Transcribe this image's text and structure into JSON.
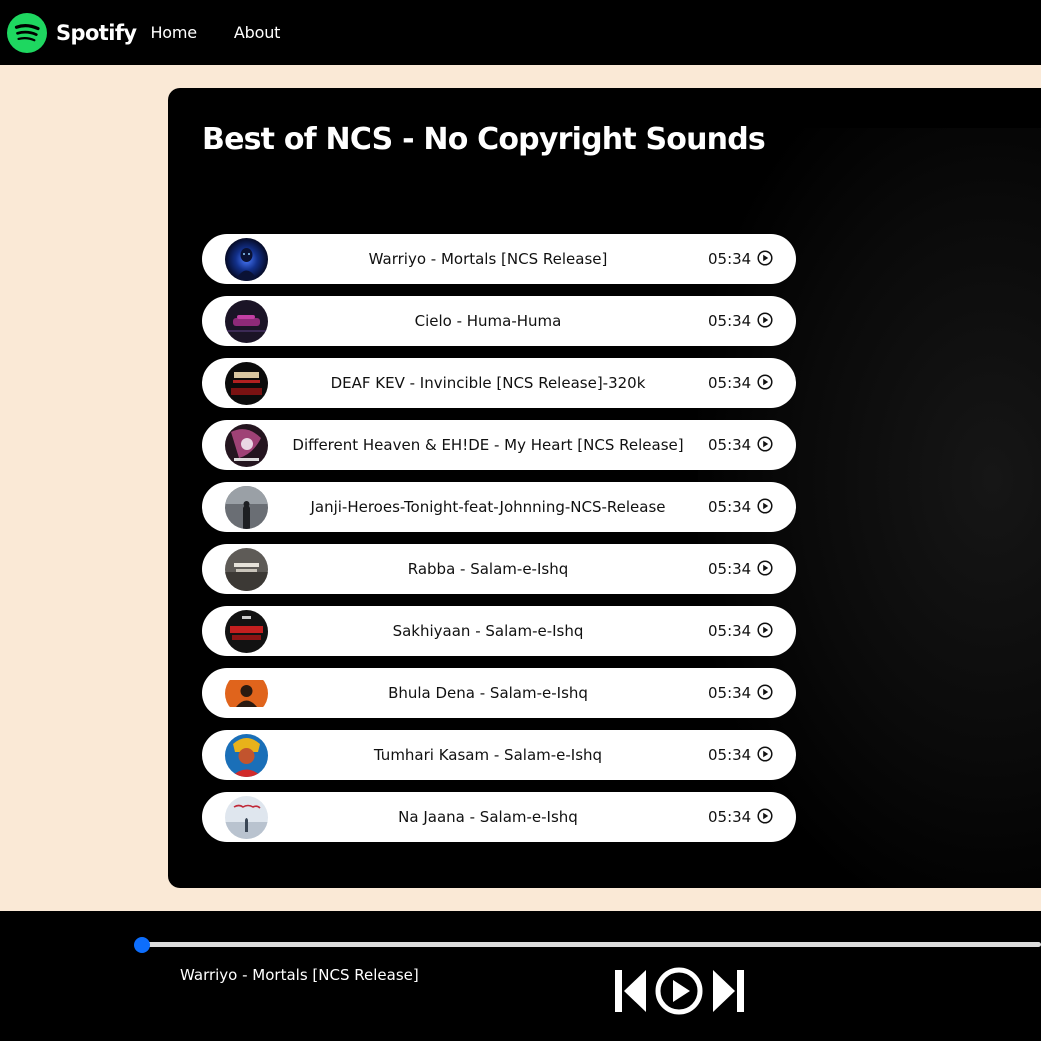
{
  "nav": {
    "brand": "Spotify",
    "links": [
      "Home",
      "About"
    ]
  },
  "playlist": {
    "title": "Best of NCS - No Copyright Sounds",
    "songs": [
      {
        "name": "Warriyo - Mortals [NCS Release]",
        "duration": "05:34",
        "cover": "cover-blue-figure"
      },
      {
        "name": "Cielo - Huma-Huma",
        "duration": "05:34",
        "cover": "cover-neon-car"
      },
      {
        "name": "DEAF KEV - Invincible [NCS Release]-320k",
        "duration": "05:34",
        "cover": "cover-red-text"
      },
      {
        "name": "Different Heaven & EH!DE - My Heart [NCS Release]",
        "duration": "05:34",
        "cover": "cover-pink-art"
      },
      {
        "name": "Janji-Heroes-Tonight-feat-Johnning-NCS-Release",
        "duration": "05:34",
        "cover": "cover-grey-figure"
      },
      {
        "name": "Rabba - Salam-e-Ishq",
        "duration": "05:34",
        "cover": "cover-grey-text"
      },
      {
        "name": "Sakhiyaan - Salam-e-Ishq",
        "duration": "05:34",
        "cover": "cover-red-text-dark"
      },
      {
        "name": "Bhula Dena - Salam-e-Ishq",
        "duration": "05:34",
        "cover": "cover-orange-portrait"
      },
      {
        "name": "Tumhari Kasam - Salam-e-Ishq",
        "duration": "05:34",
        "cover": "cover-colorful-portrait"
      },
      {
        "name": "Na Jaana - Salam-e-Ishq",
        "duration": "05:34",
        "cover": "cover-true-love"
      }
    ]
  },
  "player": {
    "now_playing": "Warriyo - Mortals [NCS Release]",
    "progress": 0,
    "controls": [
      "previous-icon",
      "play-icon",
      "next-icon"
    ],
    "accent": "#0d6efd"
  },
  "colors": {
    "page_bg": "#fae9d6",
    "container_bg": "#000000",
    "brand_green": "#1ed760"
  }
}
